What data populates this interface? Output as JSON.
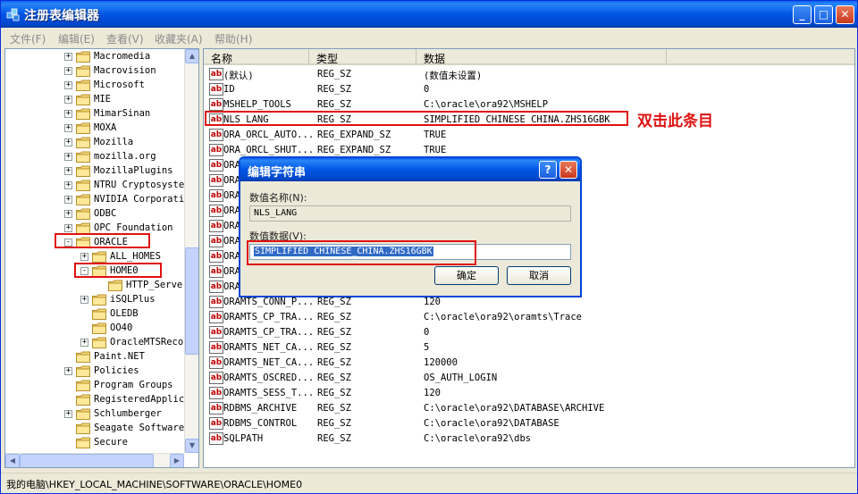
{
  "window": {
    "title": "注册表编辑器",
    "minimize": "_",
    "maximize": "□",
    "close": "✕"
  },
  "menu": [
    "文件(F)",
    "编辑(E)",
    "查看(V)",
    "收藏夹(A)",
    "帮助(H)"
  ],
  "tree": [
    {
      "label": "Macromedia",
      "indent": 0,
      "expander": "+"
    },
    {
      "label": "Macrovision",
      "indent": 0,
      "expander": "+"
    },
    {
      "label": "Microsoft",
      "indent": 0,
      "expander": "+"
    },
    {
      "label": "MIE",
      "indent": 0,
      "expander": "+"
    },
    {
      "label": "MimarSinan",
      "indent": 0,
      "expander": "+"
    },
    {
      "label": "MOXA",
      "indent": 0,
      "expander": "+"
    },
    {
      "label": "Mozilla",
      "indent": 0,
      "expander": "+"
    },
    {
      "label": "mozilla.org",
      "indent": 0,
      "expander": "+"
    },
    {
      "label": "MozillaPlugins",
      "indent": 0,
      "expander": "+"
    },
    {
      "label": "NTRU Cryptosyste",
      "indent": 0,
      "expander": "+"
    },
    {
      "label": "NVIDIA Corporati",
      "indent": 0,
      "expander": "+"
    },
    {
      "label": "ODBC",
      "indent": 0,
      "expander": "+"
    },
    {
      "label": "OPC Foundation",
      "indent": 0,
      "expander": "+"
    },
    {
      "label": "ORACLE",
      "indent": 0,
      "expander": "-"
    },
    {
      "label": "ALL_HOMES",
      "indent": 1,
      "expander": "+"
    },
    {
      "label": "HOME0",
      "indent": 1,
      "expander": "-"
    },
    {
      "label": "HTTP_Serve",
      "indent": 2,
      "expander": ""
    },
    {
      "label": "iSQLPlus",
      "indent": 1,
      "expander": "+"
    },
    {
      "label": "OLEDB",
      "indent": 1,
      "expander": ""
    },
    {
      "label": "OO40",
      "indent": 1,
      "expander": ""
    },
    {
      "label": "OracleMTSReco",
      "indent": 1,
      "expander": "+"
    },
    {
      "label": "Paint.NET",
      "indent": 0,
      "expander": ""
    },
    {
      "label": "Policies",
      "indent": 0,
      "expander": "+"
    },
    {
      "label": "Program Groups",
      "indent": 0,
      "expander": ""
    },
    {
      "label": "RegisteredApplic",
      "indent": 0,
      "expander": ""
    },
    {
      "label": "Schlumberger",
      "indent": 0,
      "expander": "+"
    },
    {
      "label": "Seagate Software",
      "indent": 0,
      "expander": ""
    },
    {
      "label": "Secure",
      "indent": 0,
      "expander": ""
    }
  ],
  "list": {
    "headers": [
      "名称",
      "类型",
      "数据"
    ],
    "rows": [
      [
        "(默认)",
        "REG_SZ",
        "(数值未设置)"
      ],
      [
        "ID",
        "REG_SZ",
        "0"
      ],
      [
        "MSHELP_TOOLS",
        "REG_SZ",
        "C:\\oracle\\ora92\\MSHELP"
      ],
      [
        "NLS_LANG",
        "REG_SZ",
        "SIMPLIFIED CHINESE_CHINA.ZHS16GBK"
      ],
      [
        "ORA_ORCL_AUTO...",
        "REG_EXPAND_SZ",
        "TRUE"
      ],
      [
        "ORA_ORCL_SHUT...",
        "REG_EXPAND_SZ",
        "TRUE"
      ],
      [
        "ORA",
        "",
        ""
      ],
      [
        "ORA",
        "",
        ""
      ],
      [
        "ORA",
        "",
        ""
      ],
      [
        "ORA",
        "",
        ""
      ],
      [
        "ORA",
        "",
        ""
      ],
      [
        "ORA",
        "",
        ""
      ],
      [
        "ORA",
        "",
        ""
      ],
      [
        "ORA",
        "",
        ""
      ],
      [
        "ORA",
        "",
        ""
      ],
      [
        "ORAMTS_CONN_P...",
        "REG_SZ",
        "120"
      ],
      [
        "ORAMTS_CP_TRA...",
        "REG_SZ",
        "C:\\oracle\\ora92\\oramts\\Trace"
      ],
      [
        "ORAMTS_CP_TRA...",
        "REG_SZ",
        "0"
      ],
      [
        "ORAMTS_NET_CA...",
        "REG_SZ",
        "5"
      ],
      [
        "ORAMTS_NET_CA...",
        "REG_SZ",
        "120000"
      ],
      [
        "ORAMTS_OSCRED...",
        "REG_SZ",
        "OS_AUTH_LOGIN"
      ],
      [
        "ORAMTS_SESS_T...",
        "REG_SZ",
        "120"
      ],
      [
        "RDBMS_ARCHIVE",
        "REG_SZ",
        "C:\\oracle\\ora92\\DATABASE\\ARCHIVE"
      ],
      [
        "RDBMS_CONTROL",
        "REG_SZ",
        "C:\\oracle\\ora92\\DATABASE"
      ],
      [
        "SQLPATH",
        "REG_SZ",
        "C:\\oracle\\ora92\\dbs"
      ]
    ]
  },
  "annotation": "双击此条目",
  "dialog": {
    "title": "编辑字符串",
    "help": "?",
    "close": "✕",
    "name_label": "数值名称(N):",
    "name_value": "NLS_LANG",
    "data_label": "数值数据(V):",
    "data_value": "SIMPLIFIED CHINESE_CHINA.ZHS16GBK",
    "ok": "确定",
    "cancel": "取消"
  },
  "status": "我的电脑\\HKEY_LOCAL_MACHINE\\SOFTWARE\\ORACLE\\HOME0",
  "colors": {
    "title_blue": "#0055e5",
    "highlight_red": "#e01010",
    "selection": "#316ac5"
  }
}
